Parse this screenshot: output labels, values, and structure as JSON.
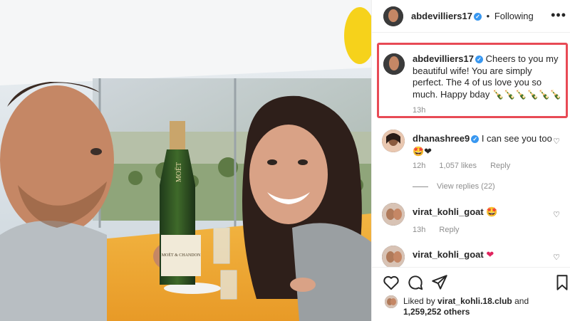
{
  "post": {
    "author": "abdevilliers17",
    "follow_status": "Following",
    "dot": "•",
    "more": "•••"
  },
  "caption": {
    "author": "abdevilliers17",
    "text": "Cheers to you my beautiful wife! You are simply perfect. The 4 of us love you so much. Happy bday 🍾🍾🍾🍾🍾🍾",
    "time": "13h"
  },
  "comments": [
    {
      "author": "dhanashree9",
      "text": "I can see you too",
      "emoji": "🤩❤",
      "time": "12h",
      "likes": "1,057 likes",
      "reply": "Reply",
      "view_replies": "View replies (22)"
    },
    {
      "author": "virat_kohli_goat",
      "emoji": "🤩",
      "time": "13h",
      "reply": "Reply"
    },
    {
      "author": "virat_kohli_goat",
      "emoji": "❤"
    }
  ],
  "likes": {
    "prefix": "Liked by",
    "by": "virat_kohli.18.club",
    "and": "and",
    "others": "1,259,252 others"
  },
  "icons": [
    "heart-icon",
    "comment-icon",
    "share-icon",
    "bookmark-icon",
    "verified-icon",
    "more-icon"
  ],
  "colors": {
    "highlight": "#e84a55",
    "verified": "#3897f0",
    "meta": "#8e8e8e"
  },
  "photo_text": {
    "bottle_brand": "MOËT",
    "bottle_label": "MOËT & CHANDON"
  }
}
